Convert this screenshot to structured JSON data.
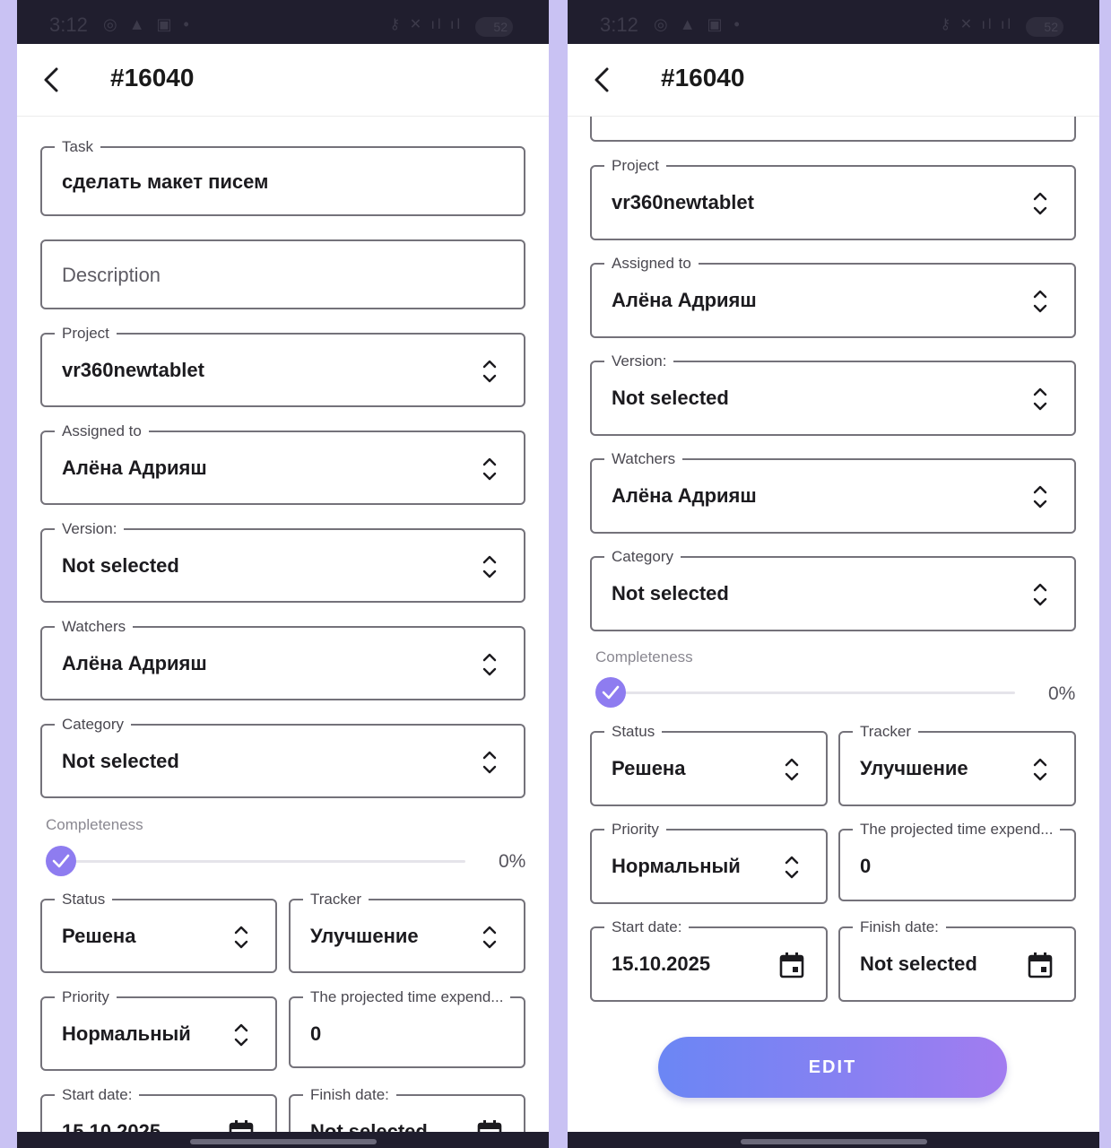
{
  "status_bar": {
    "time": "3:12",
    "battery": "52"
  },
  "app_bar": {
    "title": "#16040"
  },
  "form": {
    "task": {
      "label": "Task",
      "value": "сделать макет писем"
    },
    "description": {
      "placeholder": "Description"
    },
    "project": {
      "label": "Project",
      "value": "vr360newtablet"
    },
    "assigned_to": {
      "label": "Assigned to",
      "value": "Алёна Адрияш"
    },
    "version": {
      "label": "Version:",
      "value": "Not selected"
    },
    "watchers": {
      "label": "Watchers",
      "value": "Алёна Адрияш"
    },
    "category": {
      "label": "Category",
      "value": "Not selected"
    },
    "completeness": {
      "label": "Completeness",
      "value": "0%",
      "fraction": 0
    },
    "status": {
      "label": "Status",
      "value": "Решена"
    },
    "tracker": {
      "label": "Tracker",
      "value": "Улучшение"
    },
    "priority": {
      "label": "Priority",
      "value": "Нормальный"
    },
    "projected_time": {
      "label": "The projected time expend...",
      "value": "0"
    },
    "start_date": {
      "label": "Start date:",
      "value": "15.10.2025"
    },
    "finish_date": {
      "label": "Finish date:",
      "value": "Not selected"
    }
  },
  "actions": {
    "edit_label": "EDIT"
  },
  "colors": {
    "accent": "#8e7cf0",
    "background": "#c9c2f3",
    "status_bar": "#201e2e"
  }
}
